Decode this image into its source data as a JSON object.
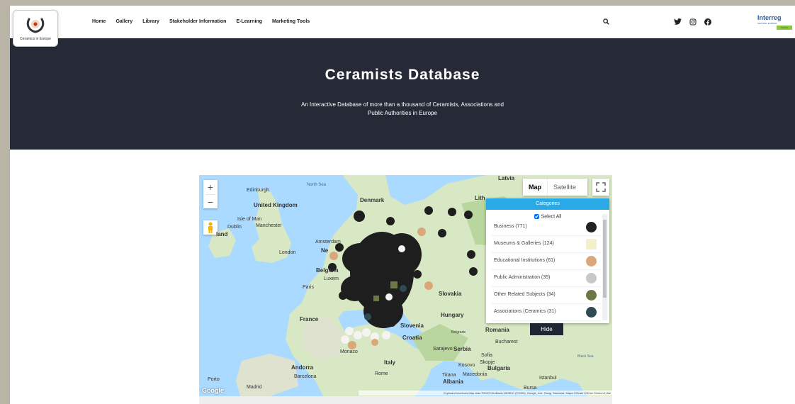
{
  "logo": {
    "caption": "Ceramics in Europe"
  },
  "nav": {
    "items": [
      "Home",
      "Gallery",
      "Library",
      "Stakeholder Information",
      "E-Learning",
      "Marketing Tools"
    ]
  },
  "interreg": {
    "name": "Interreg",
    "subtitle": "CENTRAL EUROPE",
    "tag": "CerDee"
  },
  "hero": {
    "title": "Ceramists Database",
    "subtitle_line1": "An Interactive Database of more than a thousand of Ceramists, Associations and",
    "subtitle_line2": "Public Authorities in Europe"
  },
  "map": {
    "map_type": {
      "map": "Map",
      "satellite": "Satellite"
    },
    "labels": [
      "North Sea",
      "Denmark",
      "Edinburgh",
      "United Kingdom",
      "Isle of Man",
      "Manchester",
      "Dublin",
      "land",
      "London",
      "Amsterdam",
      "Ne",
      "Belgium",
      "Luxem",
      "Paris",
      "France",
      "Latvia",
      "Lith",
      "Slovakia",
      "Hungary",
      "Slovenia",
      "Croatia",
      "Romania",
      "Bucharest",
      "Belgrade",
      "Sarajevo",
      "Serbia",
      "Sofia",
      "Bulgaria",
      "Kosovo",
      "Skopje",
      "Tirana",
      "Macedonia",
      "Albania",
      "Istanbul",
      "Bursa",
      "Monaco",
      "Italy",
      "Rome",
      "Andorra",
      "Barcelona",
      "Porto",
      "Madrid",
      "Black Sea"
    ],
    "attribution": "Keyboard shortcuts  Map data ©2022 GeoBasis-DE/BKG (©2009), Google, Inst. Geogr. Nacional, Mapa GISrael  200 km  Terms of Use",
    "google": "Google"
  },
  "categories": {
    "header": "Categories",
    "select_all": "Select All",
    "items": [
      {
        "label": "Business (771)",
        "color": "#222222"
      },
      {
        "label": "Museums & Galleries (124)",
        "color": "#f3efc9"
      },
      {
        "label": "Educational Institutions (61)",
        "color": "#d9a77a"
      },
      {
        "label": "Public Administration (35)",
        "color": "#c8c8c8"
      },
      {
        "label": "Other Related Subjects (34)",
        "color": "#6b7a45"
      },
      {
        "label": "Associations (Ceramics (31)",
        "color": "#2e4a52"
      }
    ],
    "hide": "Hide"
  }
}
